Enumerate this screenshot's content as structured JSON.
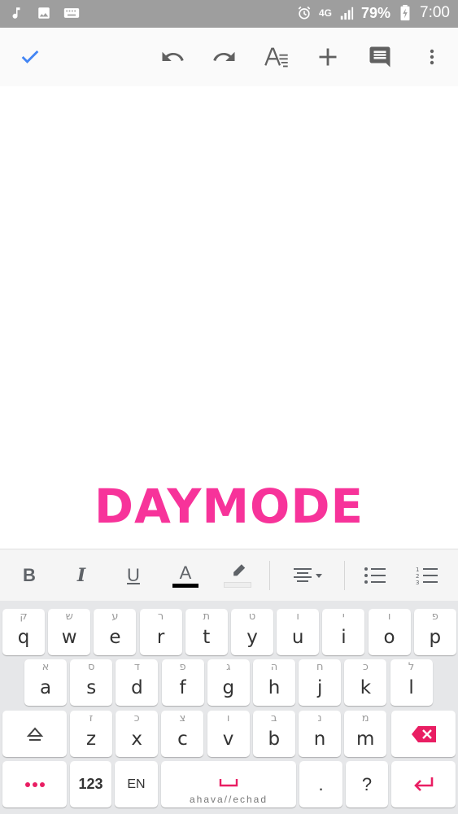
{
  "status_bar": {
    "battery_percent": "79%",
    "time": "7:00",
    "network": "4G",
    "icons_left": [
      "music-note-icon",
      "image-icon",
      "keyboard-icon"
    ],
    "icons_right": [
      "alarm-icon",
      "network-icon",
      "signal-icon",
      "battery-charging-icon"
    ]
  },
  "toolbar": {
    "icons": [
      "check-icon",
      "undo-icon",
      "redo-icon",
      "text-format-icon",
      "add-icon",
      "comment-icon",
      "more-vert-icon"
    ],
    "accent_color": "#4285f4"
  },
  "document": {
    "watermark": "DAYMODE",
    "watermark_color": "#f7339a"
  },
  "format_bar": {
    "bold": "B",
    "italic": "I",
    "underline": "U",
    "text_color": "A",
    "icons": [
      "bold-icon",
      "italic-icon",
      "underline-icon",
      "text-color-icon",
      "highlight-icon",
      "align-icon",
      "bullet-list-icon",
      "numbered-list-icon"
    ]
  },
  "keyboard": {
    "row1": [
      {
        "key": "q",
        "hint": "ק"
      },
      {
        "key": "w",
        "hint": "ש"
      },
      {
        "key": "e",
        "hint": "ע"
      },
      {
        "key": "r",
        "hint": "ר"
      },
      {
        "key": "t",
        "hint": "ת"
      },
      {
        "key": "y",
        "hint": "ט"
      },
      {
        "key": "u",
        "hint": "ו"
      },
      {
        "key": "i",
        "hint": "י"
      },
      {
        "key": "o",
        "hint": "ו"
      },
      {
        "key": "p",
        "hint": "פ"
      }
    ],
    "row2": [
      {
        "key": "a",
        "hint": "א"
      },
      {
        "key": "s",
        "hint": "ס"
      },
      {
        "key": "d",
        "hint": "ד"
      },
      {
        "key": "f",
        "hint": "פ"
      },
      {
        "key": "g",
        "hint": "ג"
      },
      {
        "key": "h",
        "hint": "ה"
      },
      {
        "key": "j",
        "hint": "ח"
      },
      {
        "key": "k",
        "hint": "כ"
      },
      {
        "key": "l",
        "hint": "ל"
      }
    ],
    "row3": [
      {
        "key": "z",
        "hint": "ז"
      },
      {
        "key": "x",
        "hint": "כ"
      },
      {
        "key": "c",
        "hint": "צ"
      },
      {
        "key": "v",
        "hint": "ו"
      },
      {
        "key": "b",
        "hint": "ב"
      },
      {
        "key": "n",
        "hint": "נ"
      },
      {
        "key": "m",
        "hint": "מ"
      }
    ],
    "numbers_label": "123",
    "language_label": "EN",
    "spacebar_label": "ahava//echad",
    "period_label": ".",
    "question_label": "?",
    "accent_color": "#e91e63"
  }
}
